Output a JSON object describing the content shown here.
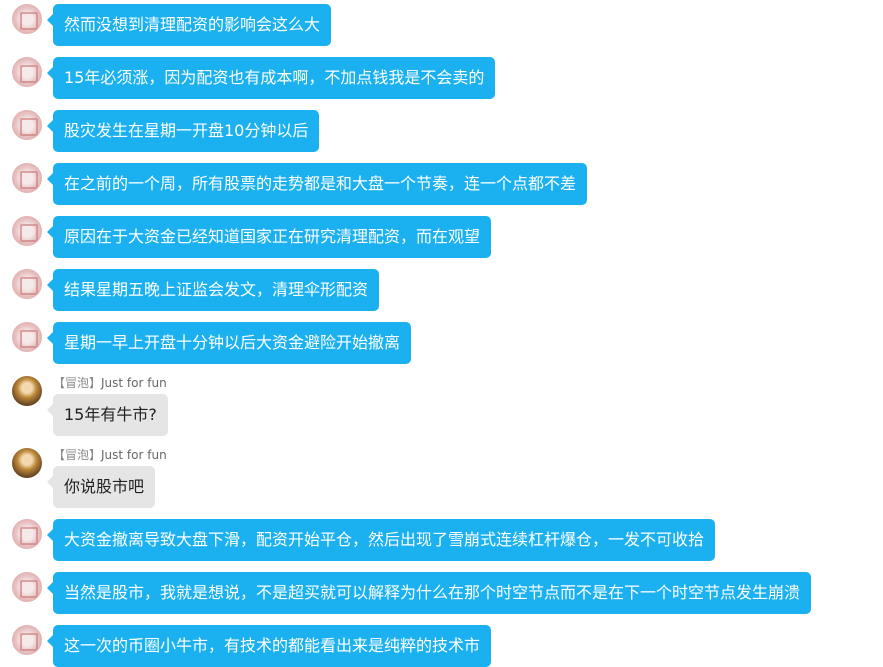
{
  "messages": [
    {
      "text": "然而没想到清理配资的影响会这么大"
    },
    {
      "text": "15年必须涨，因为配资也有成本啊，不加点钱我是不会卖的"
    },
    {
      "text": "股灾发生在星期一开盘10分钟以后"
    },
    {
      "text": "在之前的一个周，所有股票的走势都是和大盘一个节奏，连一个点都不差"
    },
    {
      "text": "原因在于大资金已经知道国家正在研究清理配资，而在观望"
    },
    {
      "text": "结果星期五晚上证监会发文，清理伞形配资"
    },
    {
      "text": "星期一早上开盘十分钟以后大资金避险开始撤离"
    },
    {
      "sender_tag": "【冒泡】",
      "sender_name": "Just for fun",
      "text": "15年有牛市?"
    },
    {
      "sender_tag": "【冒泡】",
      "sender_name": "Just for fun",
      "text": "你说股市吧"
    },
    {
      "text": "大资金撤离导致大盘下滑，配资开始平仓，然后出现了雪崩式连续杠杆爆仓，一发不可收拾"
    },
    {
      "text": "当然是股市，我就是想说，不是超买就可以解释为什么在那个时空节点而不是在下一个时空节点发生崩溃"
    },
    {
      "text": "这一次的币圈小牛市，有技术的都能看出来是纯粹的技术市"
    }
  ],
  "colors": {
    "outgoing_bubble": "#1bb1f0",
    "incoming_bubble": "#e5e5e5"
  }
}
